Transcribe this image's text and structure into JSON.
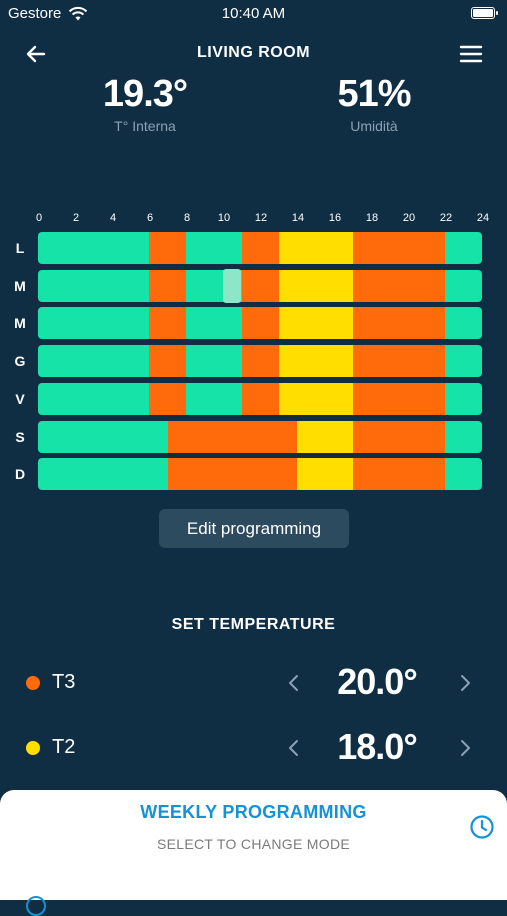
{
  "status": {
    "carrier": "Gestore",
    "time": "10:40 AM"
  },
  "header": {
    "title": "LIVING ROOM"
  },
  "readings": {
    "temperature": {
      "value": "19.3°",
      "label": "T° Interna"
    },
    "humidity": {
      "value": "51%",
      "label": "Umidità"
    }
  },
  "schedule": {
    "hour_labels": [
      "0",
      "2",
      "4",
      "6",
      "8",
      "10",
      "12",
      "14",
      "16",
      "18",
      "20",
      "22",
      "24"
    ],
    "mode_colors": {
      "T1": "#16e3a8",
      "T2": "#ffde00",
      "T3": "#ff6b0b"
    },
    "days": [
      {
        "label": "L",
        "segments": [
          [
            "T1",
            0,
            6
          ],
          [
            "T3",
            6,
            8
          ],
          [
            "T1",
            8,
            11
          ],
          [
            "T3",
            11,
            13
          ],
          [
            "T2",
            13,
            17
          ],
          [
            "T3",
            17,
            22
          ],
          [
            "T1",
            22,
            24
          ]
        ]
      },
      {
        "label": "M",
        "segments": [
          [
            "T1",
            0,
            6
          ],
          [
            "T3",
            6,
            8
          ],
          [
            "T1",
            8,
            11
          ],
          [
            "T3",
            11,
            13
          ],
          [
            "T2",
            13,
            17
          ],
          [
            "T3",
            17,
            22
          ],
          [
            "T1",
            22,
            24
          ]
        ]
      },
      {
        "label": "M",
        "segments": [
          [
            "T1",
            0,
            6
          ],
          [
            "T3",
            6,
            8
          ],
          [
            "T1",
            8,
            11
          ],
          [
            "T3",
            11,
            13
          ],
          [
            "T2",
            13,
            17
          ],
          [
            "T3",
            17,
            22
          ],
          [
            "T1",
            22,
            24
          ]
        ]
      },
      {
        "label": "G",
        "segments": [
          [
            "T1",
            0,
            6
          ],
          [
            "T3",
            6,
            8
          ],
          [
            "T1",
            8,
            11
          ],
          [
            "T3",
            11,
            13
          ],
          [
            "T2",
            13,
            17
          ],
          [
            "T3",
            17,
            22
          ],
          [
            "T1",
            22,
            24
          ]
        ]
      },
      {
        "label": "V",
        "segments": [
          [
            "T1",
            0,
            6
          ],
          [
            "T3",
            6,
            8
          ],
          [
            "T1",
            8,
            11
          ],
          [
            "T3",
            11,
            13
          ],
          [
            "T2",
            13,
            17
          ],
          [
            "T3",
            17,
            22
          ],
          [
            "T1",
            22,
            24
          ]
        ]
      },
      {
        "label": "S",
        "segments": [
          [
            "T1",
            0,
            7
          ],
          [
            "T3",
            7,
            14
          ],
          [
            "T2",
            14,
            17
          ],
          [
            "T3",
            17,
            22
          ],
          [
            "T1",
            22,
            24
          ]
        ]
      },
      {
        "label": "D",
        "segments": [
          [
            "T1",
            0,
            7
          ],
          [
            "T3",
            7,
            14
          ],
          [
            "T2",
            14,
            17
          ],
          [
            "T3",
            17,
            22
          ],
          [
            "T1",
            22,
            24
          ]
        ]
      }
    ]
  },
  "edit_button": {
    "label": "Edit programming"
  },
  "set_temperature": {
    "title": "SET TEMPERATURE",
    "rows": [
      {
        "name": "T3",
        "color": "#ff6b0b",
        "value": "20.0°"
      },
      {
        "name": "T2",
        "color": "#ffde00",
        "value": "18.0°"
      }
    ]
  },
  "bottom_sheet": {
    "title": "WEEKLY PROGRAMMING",
    "subtitle": "SELECT TO CHANGE MODE"
  },
  "icons": [
    "back-arrow-icon",
    "hamburger-menu-icon",
    "wifi-icon",
    "battery-icon",
    "chevron-left-icon",
    "chevron-right-icon",
    "clock-icon"
  ]
}
